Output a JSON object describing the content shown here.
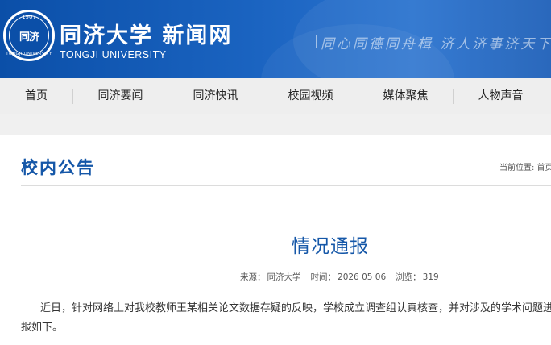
{
  "header": {
    "logo_year": "1907",
    "logo_mark": "同济",
    "logo_ring": "TONGJI UNIVERSITY",
    "site_name": "同济大学 新闻网",
    "university_en": "TONGJI UNIVERSITY",
    "motto": "同心同德同舟楫  济人济事济天下",
    "brand_color": "#0b4fa8"
  },
  "nav": {
    "items": [
      {
        "label": "首页"
      },
      {
        "label": "同济要闻"
      },
      {
        "label": "同济快讯"
      },
      {
        "label": "校园视频"
      },
      {
        "label": "媒体聚焦"
      },
      {
        "label": "人物声音"
      }
    ]
  },
  "section": {
    "title": "校内公告",
    "breadcrumb": "当前位置: 首页"
  },
  "article": {
    "title": "情况通报",
    "source_label": "来源：",
    "source": "同济大学",
    "time_label": "时间：",
    "time": "2026 05 06",
    "views_label": "浏览：",
    "views": "319",
    "paragraph_line1": "近日，针对网络上对我校教师王某相关论文数据存疑的反映，学校成立调查组认真核查，并对涉及的学术问题进行",
    "paragraph_line2": "报如下。",
    "title_color": "#1557a8"
  }
}
